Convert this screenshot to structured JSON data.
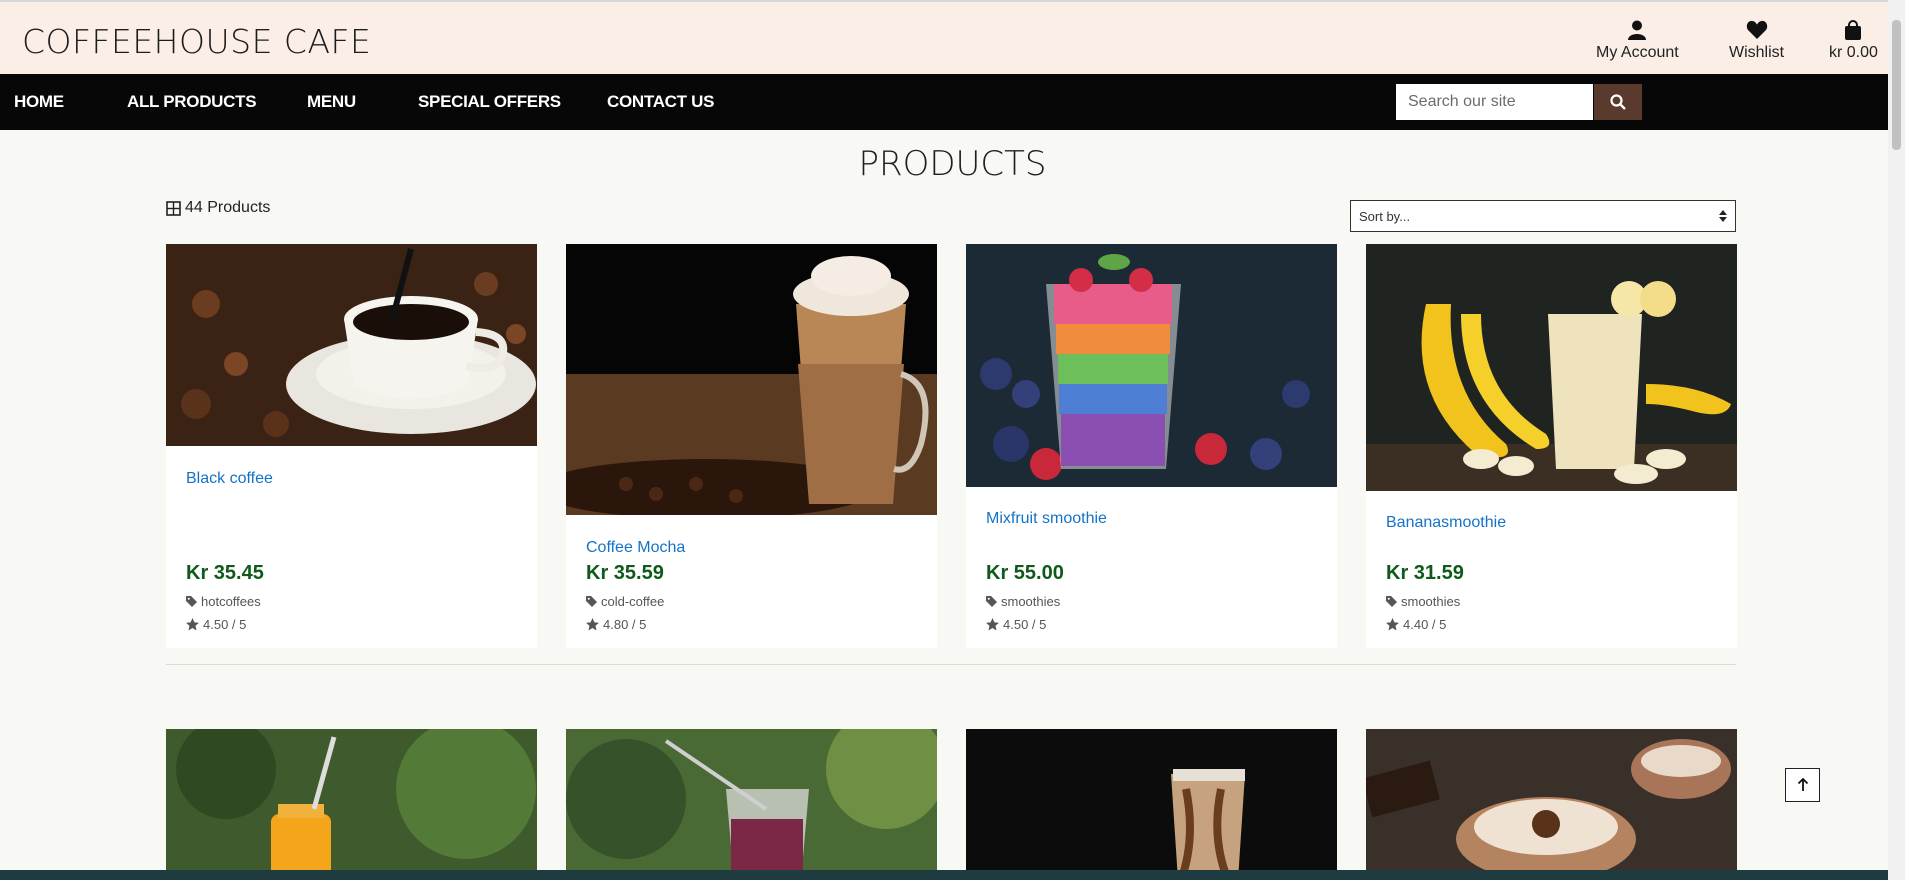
{
  "brand": "COFFEEHOUSE CAFE",
  "header": {
    "account_label": "My Account",
    "wishlist_label": "Wishlist",
    "bag_total": "kr 0.00"
  },
  "nav": {
    "items": [
      "HOME",
      "ALL PRODUCTS",
      "MENU",
      "SPECIAL OFFERS",
      "CONTACT US"
    ],
    "search_placeholder": "Search our site"
  },
  "main": {
    "title": "PRODUCTS",
    "count": "44 Products",
    "sort_label": "Sort by..."
  },
  "products": [
    {
      "name": "Black coffee",
      "price": "Kr 35.45",
      "category": "hotcoffees",
      "rating": "4.50 / 5"
    },
    {
      "name": "Coffee Mocha",
      "price": "Kr 35.59",
      "category": "cold-coffee",
      "rating": "4.80 / 5"
    },
    {
      "name": "Mixfruit smoothie",
      "price": "Kr 55.00",
      "category": "smoothies",
      "rating": "4.50 / 5"
    },
    {
      "name": "Bananasmoothie",
      "price": "Kr 31.59",
      "category": "smoothies",
      "rating": "4.40 / 5"
    }
  ],
  "colors": {
    "topbar": "#fbeee6",
    "navbar": "#070707",
    "search_button": "#5b3a2e",
    "link": "#1473c8",
    "price": "#0f5a1a"
  },
  "icons": [
    "user-icon",
    "heart-icon",
    "shopping-bag-icon",
    "search-icon",
    "grid-icon",
    "sort-arrows-icon",
    "tag-icon",
    "star-icon",
    "arrow-up-icon"
  ]
}
